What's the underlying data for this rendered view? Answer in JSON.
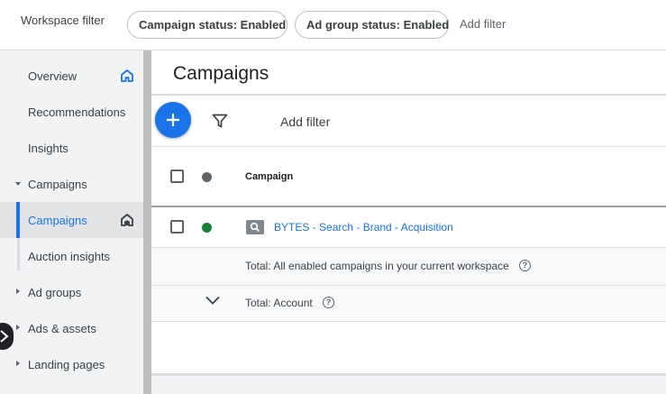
{
  "filter_bar": {
    "label": "Workspace filter",
    "chips": [
      "Campaign status: Enabled",
      "Ad group status: Enabled"
    ],
    "add_filter": "Add filter"
  },
  "sidebar": {
    "items": [
      {
        "label": "Overview",
        "icon": "home-icon"
      },
      {
        "label": "Recommendations"
      },
      {
        "label": "Insights"
      },
      {
        "label": "Campaigns",
        "expanded": true
      },
      {
        "label": "Campaigns",
        "active": true,
        "icon": "campaigns-home-icon"
      },
      {
        "label": "Auction insights"
      },
      {
        "label": "Ad groups",
        "expanded": false
      },
      {
        "label": "Ads & assets",
        "expanded": false
      },
      {
        "label": "Landing pages",
        "expanded": false
      }
    ]
  },
  "main": {
    "title": "Campaigns",
    "toolbar": {
      "add_filter": "Add filter"
    },
    "table": {
      "header": {
        "campaign": "Campaign"
      },
      "rows": [
        {
          "name": "BYTES - Search - Brand - Acquisition",
          "status": "enabled",
          "type_icon": "search-icon"
        }
      ],
      "totals": [
        {
          "label": "Total: All enabled campaigns in your current workspace"
        },
        {
          "label": "Total: Account"
        }
      ]
    }
  },
  "colors": {
    "accent": "#1a73e8",
    "status_enabled": "#188038",
    "status_header": "#5f6368"
  }
}
